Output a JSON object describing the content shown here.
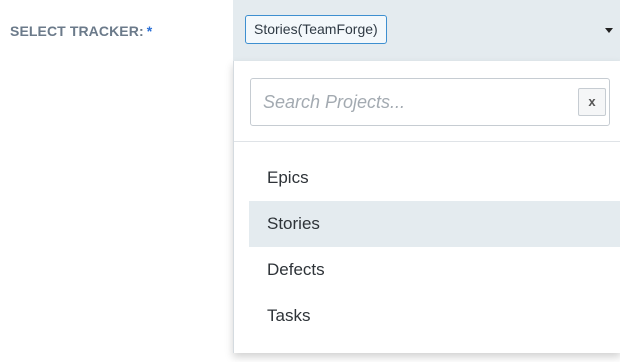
{
  "form": {
    "label": "SELECT TRACKER:",
    "required_marker": "*"
  },
  "select": {
    "selected_value": "Stories(TeamForge)"
  },
  "dropdown": {
    "search": {
      "placeholder": "Search Projects...",
      "value": "",
      "clear_label": "x"
    },
    "options": [
      {
        "label": "Epics",
        "highlighted": false
      },
      {
        "label": "Stories",
        "highlighted": true
      },
      {
        "label": "Defects",
        "highlighted": false
      },
      {
        "label": "Tasks",
        "highlighted": false
      }
    ]
  },
  "colors": {
    "select_background": "#e4ebef",
    "chip_border": "#3d8fd0",
    "label_text": "#6b7a8a",
    "highlight_row": "#e4ebef"
  }
}
